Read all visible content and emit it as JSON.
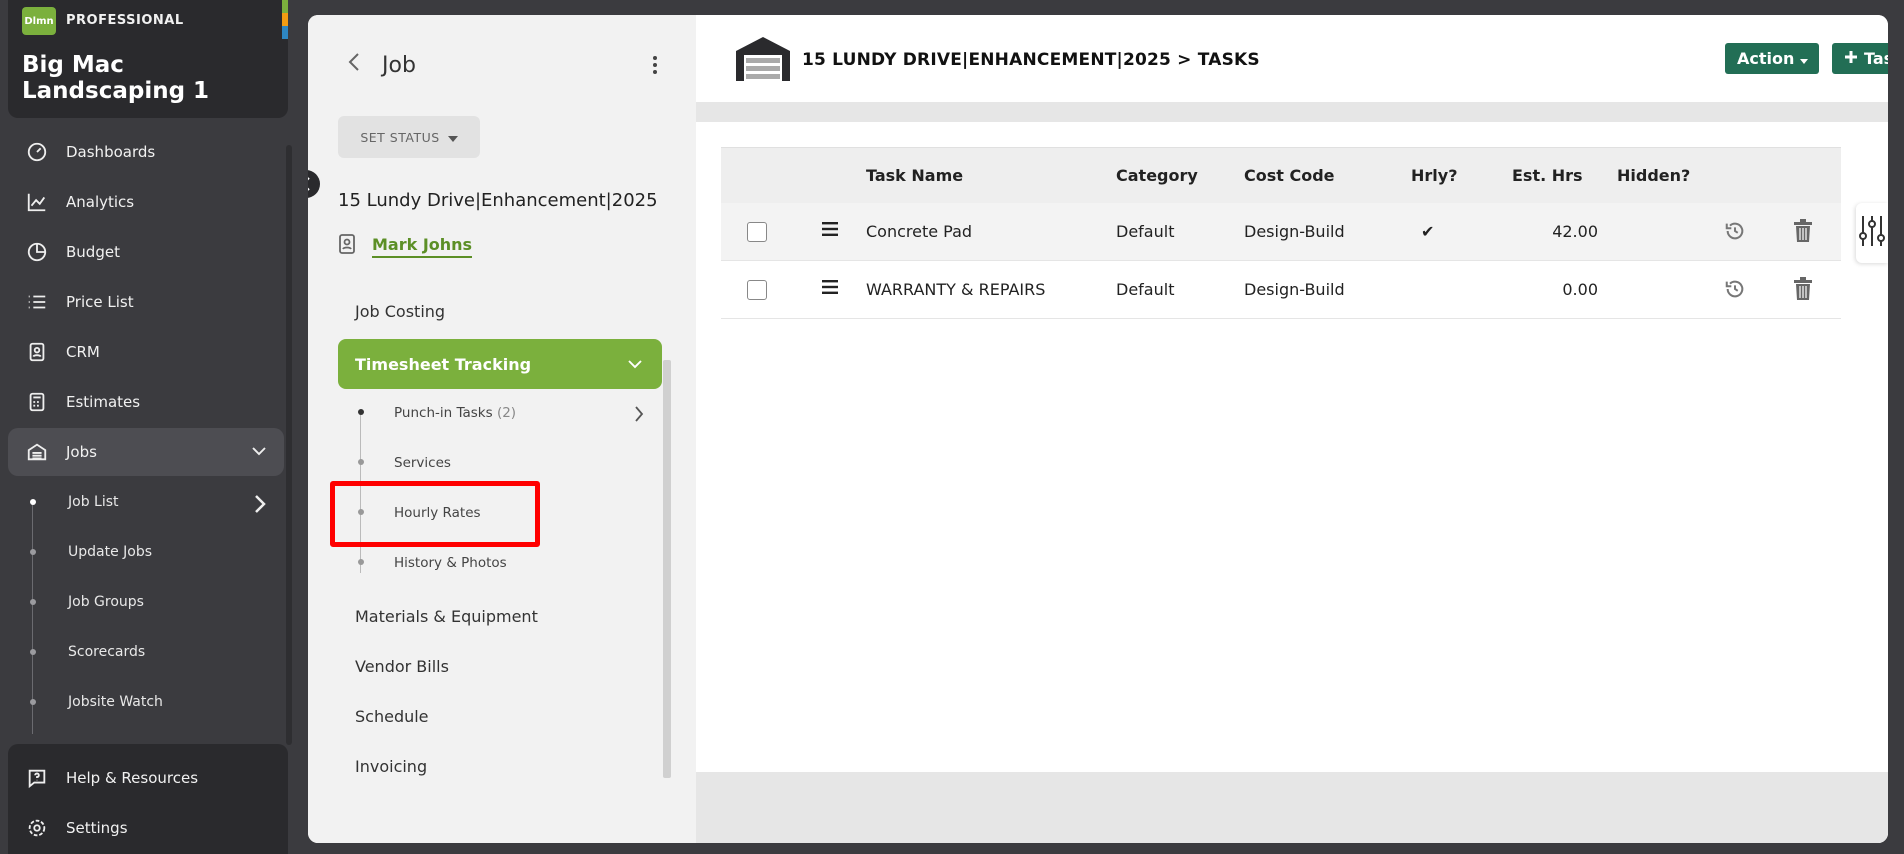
{
  "sidebar": {
    "logo_text": "Dlmn",
    "tier": "PROFESSIONAL",
    "company": "Big Mac Landscaping 1",
    "nav": [
      {
        "label": "Dashboards",
        "icon": "dashboard-icon"
      },
      {
        "label": "Analytics",
        "icon": "analytics-icon"
      },
      {
        "label": "Budget",
        "icon": "budget-icon"
      },
      {
        "label": "Price List",
        "icon": "list-icon"
      },
      {
        "label": "CRM",
        "icon": "contact-icon"
      },
      {
        "label": "Estimates",
        "icon": "calculator-icon"
      },
      {
        "label": "Jobs",
        "icon": "garage-icon"
      }
    ],
    "jobs_sub": [
      "Job List",
      "Update Jobs",
      "Job Groups",
      "Scorecards",
      "Jobsite Watch"
    ],
    "bottom": [
      {
        "label": "Help & Resources",
        "icon": "help-icon"
      },
      {
        "label": "Settings",
        "icon": "gear-icon"
      }
    ],
    "edge_colors": [
      "#7bb03d",
      "#f39c12",
      "#2e86c1"
    ]
  },
  "subnav": {
    "title": "Job",
    "status_label": "SET STATUS",
    "job_name": "15 Lundy Drive|Enhancement|2025",
    "client": "Mark Johns",
    "menu": {
      "job_costing": "Job Costing",
      "timesheet": "Timesheet Tracking",
      "punch_in": "Punch-in Tasks",
      "punch_in_count": "(2)",
      "services": "Services",
      "hourly_rates": "Hourly Rates",
      "history": "History & Photos",
      "materials": "Materials & Equipment",
      "vendor_bills": "Vendor Bills",
      "schedule": "Schedule",
      "invoicing": "Invoicing"
    }
  },
  "content": {
    "title": "15 LUNDY DRIVE|ENHANCEMENT|2025 > TASKS",
    "action_label": "Action",
    "task_label": "Task",
    "columns": {
      "task_name": "Task Name",
      "category": "Category",
      "cost_code": "Cost Code",
      "hourly": "Hrly?",
      "est_hrs": "Est. Hrs",
      "hidden": "Hidden?"
    },
    "rows": [
      {
        "task": "Concrete Pad",
        "category": "Default",
        "cost_code": "Design-Build",
        "hourly": "✔",
        "est_hrs": "42.00"
      },
      {
        "task": "WARRANTY & REPAIRS",
        "category": "Default",
        "cost_code": "Design-Build",
        "hourly": "",
        "est_hrs": "0.00"
      }
    ]
  },
  "colors": {
    "brand_green": "#7bb03d",
    "button_green": "#226e55",
    "link_green": "#5c8f26",
    "highlight_red": "#ff0000"
  }
}
